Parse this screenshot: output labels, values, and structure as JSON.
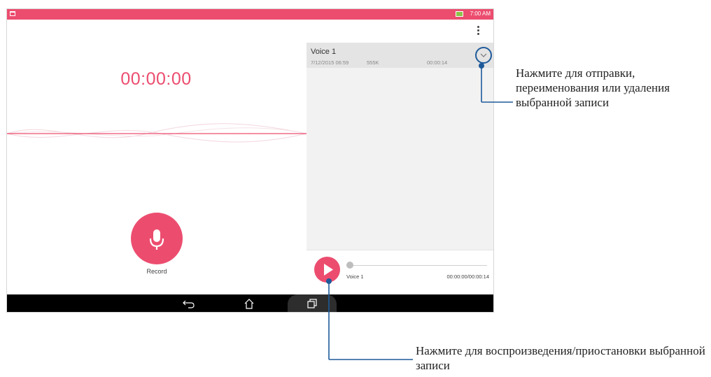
{
  "status_bar": {
    "time": "7:00 AM",
    "notification_icon": "calendar-notification-icon",
    "battery_icon": "battery-charging-icon",
    "color": "#ec4d6f"
  },
  "recorder": {
    "timer": "00:00:00",
    "record_label": "Record",
    "mic_icon": "microphone-icon",
    "accent": "#ec4d6f"
  },
  "recordings": [
    {
      "title": "Voice 1",
      "datetime": "7/12/2015 06:59",
      "size": "555K",
      "duration": "00:00:14"
    }
  ],
  "player": {
    "title": "Voice 1",
    "time": "00:00:00/00:00:14",
    "progress": 0
  },
  "navigation": {
    "back_icon": "back-icon",
    "home_icon": "home-icon",
    "recents_icon": "recent-apps-icon"
  },
  "callouts": {
    "more_options": "Нажмите для отправки, переименования или удаления выбранной записи",
    "play_pause": "Нажмите для воспроизведения/приостановки выбранной записи"
  },
  "annotation_color": "#1e5a9a"
}
